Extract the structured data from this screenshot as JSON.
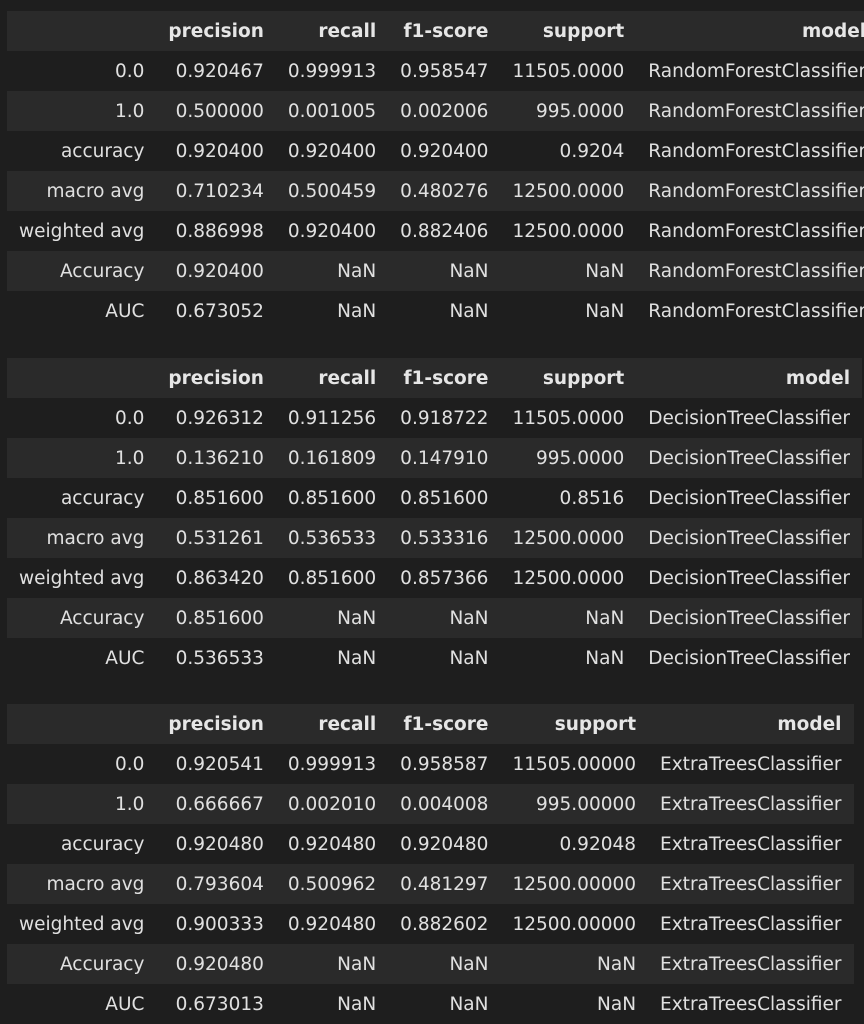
{
  "columns": [
    "",
    "precision",
    "recall",
    "f1-score",
    "support",
    "model"
  ],
  "tables": [
    {
      "rows": [
        [
          "0.0",
          "0.920467",
          "0.999913",
          "0.958547",
          "11505.0000",
          "RandomForestClassifier"
        ],
        [
          "1.0",
          "0.500000",
          "0.001005",
          "0.002006",
          "995.0000",
          "RandomForestClassifier"
        ],
        [
          "accuracy",
          "0.920400",
          "0.920400",
          "0.920400",
          "0.9204",
          "RandomForestClassifier"
        ],
        [
          "macro avg",
          "0.710234",
          "0.500459",
          "0.480276",
          "12500.0000",
          "RandomForestClassifier"
        ],
        [
          "weighted avg",
          "0.886998",
          "0.920400",
          "0.882406",
          "12500.0000",
          "RandomForestClassifier"
        ],
        [
          "Accuracy",
          "0.920400",
          "NaN",
          "NaN",
          "NaN",
          "RandomForestClassifier"
        ],
        [
          "AUC",
          "0.673052",
          "NaN",
          "NaN",
          "NaN",
          "RandomForestClassifier"
        ]
      ]
    },
    {
      "rows": [
        [
          "0.0",
          "0.926312",
          "0.911256",
          "0.918722",
          "11505.0000",
          "DecisionTreeClassifier"
        ],
        [
          "1.0",
          "0.136210",
          "0.161809",
          "0.147910",
          "995.0000",
          "DecisionTreeClassifier"
        ],
        [
          "accuracy",
          "0.851600",
          "0.851600",
          "0.851600",
          "0.8516",
          "DecisionTreeClassifier"
        ],
        [
          "macro avg",
          "0.531261",
          "0.536533",
          "0.533316",
          "12500.0000",
          "DecisionTreeClassifier"
        ],
        [
          "weighted avg",
          "0.863420",
          "0.851600",
          "0.857366",
          "12500.0000",
          "DecisionTreeClassifier"
        ],
        [
          "Accuracy",
          "0.851600",
          "NaN",
          "NaN",
          "NaN",
          "DecisionTreeClassifier"
        ],
        [
          "AUC",
          "0.536533",
          "NaN",
          "NaN",
          "NaN",
          "DecisionTreeClassifier"
        ]
      ]
    },
    {
      "rows": [
        [
          "0.0",
          "0.920541",
          "0.999913",
          "0.958587",
          "11505.00000",
          "ExtraTreesClassifier"
        ],
        [
          "1.0",
          "0.666667",
          "0.002010",
          "0.004008",
          "995.00000",
          "ExtraTreesClassifier"
        ],
        [
          "accuracy",
          "0.920480",
          "0.920480",
          "0.920480",
          "0.92048",
          "ExtraTreesClassifier"
        ],
        [
          "macro avg",
          "0.793604",
          "0.500962",
          "0.481297",
          "12500.00000",
          "ExtraTreesClassifier"
        ],
        [
          "weighted avg",
          "0.900333",
          "0.920480",
          "0.882602",
          "12500.00000",
          "ExtraTreesClassifier"
        ],
        [
          "Accuracy",
          "0.920480",
          "NaN",
          "NaN",
          "NaN",
          "ExtraTreesClassifier"
        ],
        [
          "AUC",
          "0.673013",
          "NaN",
          "NaN",
          "NaN",
          "ExtraTreesClassifier"
        ]
      ]
    }
  ],
  "colors": {
    "background": "#1e1e1e",
    "stripe": "#2a2a2a",
    "text": "#e0e0e0"
  }
}
